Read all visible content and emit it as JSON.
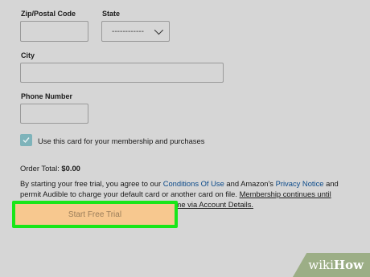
{
  "form": {
    "zip_label": "Zip/Postal Code",
    "state_label": "State",
    "state_value": "------------",
    "city_label": "City",
    "phone_label": "Phone Number",
    "use_card_label": "Use this card for your membership and purchases",
    "use_card_checked": true
  },
  "order": {
    "total_label": "Order Total:",
    "total_value": "$0.00"
  },
  "terms": {
    "part1": "By starting your free trial, you agree to our ",
    "conditions_link": "Conditions Of Use",
    "part2": " and Amazon's ",
    "privacy_link": "Privacy Notice",
    "part3": " and permit Audible to charge your default card or another card on file. ",
    "membership_link": "Membership continues until cancelled for $14.95/mo. + taxes. Cancel anytime via Account Details."
  },
  "cta": {
    "label": "Start Free Trial",
    "highlight_color": "#19e619"
  },
  "watermark": {
    "wiki": "wiki",
    "how": "How"
  }
}
